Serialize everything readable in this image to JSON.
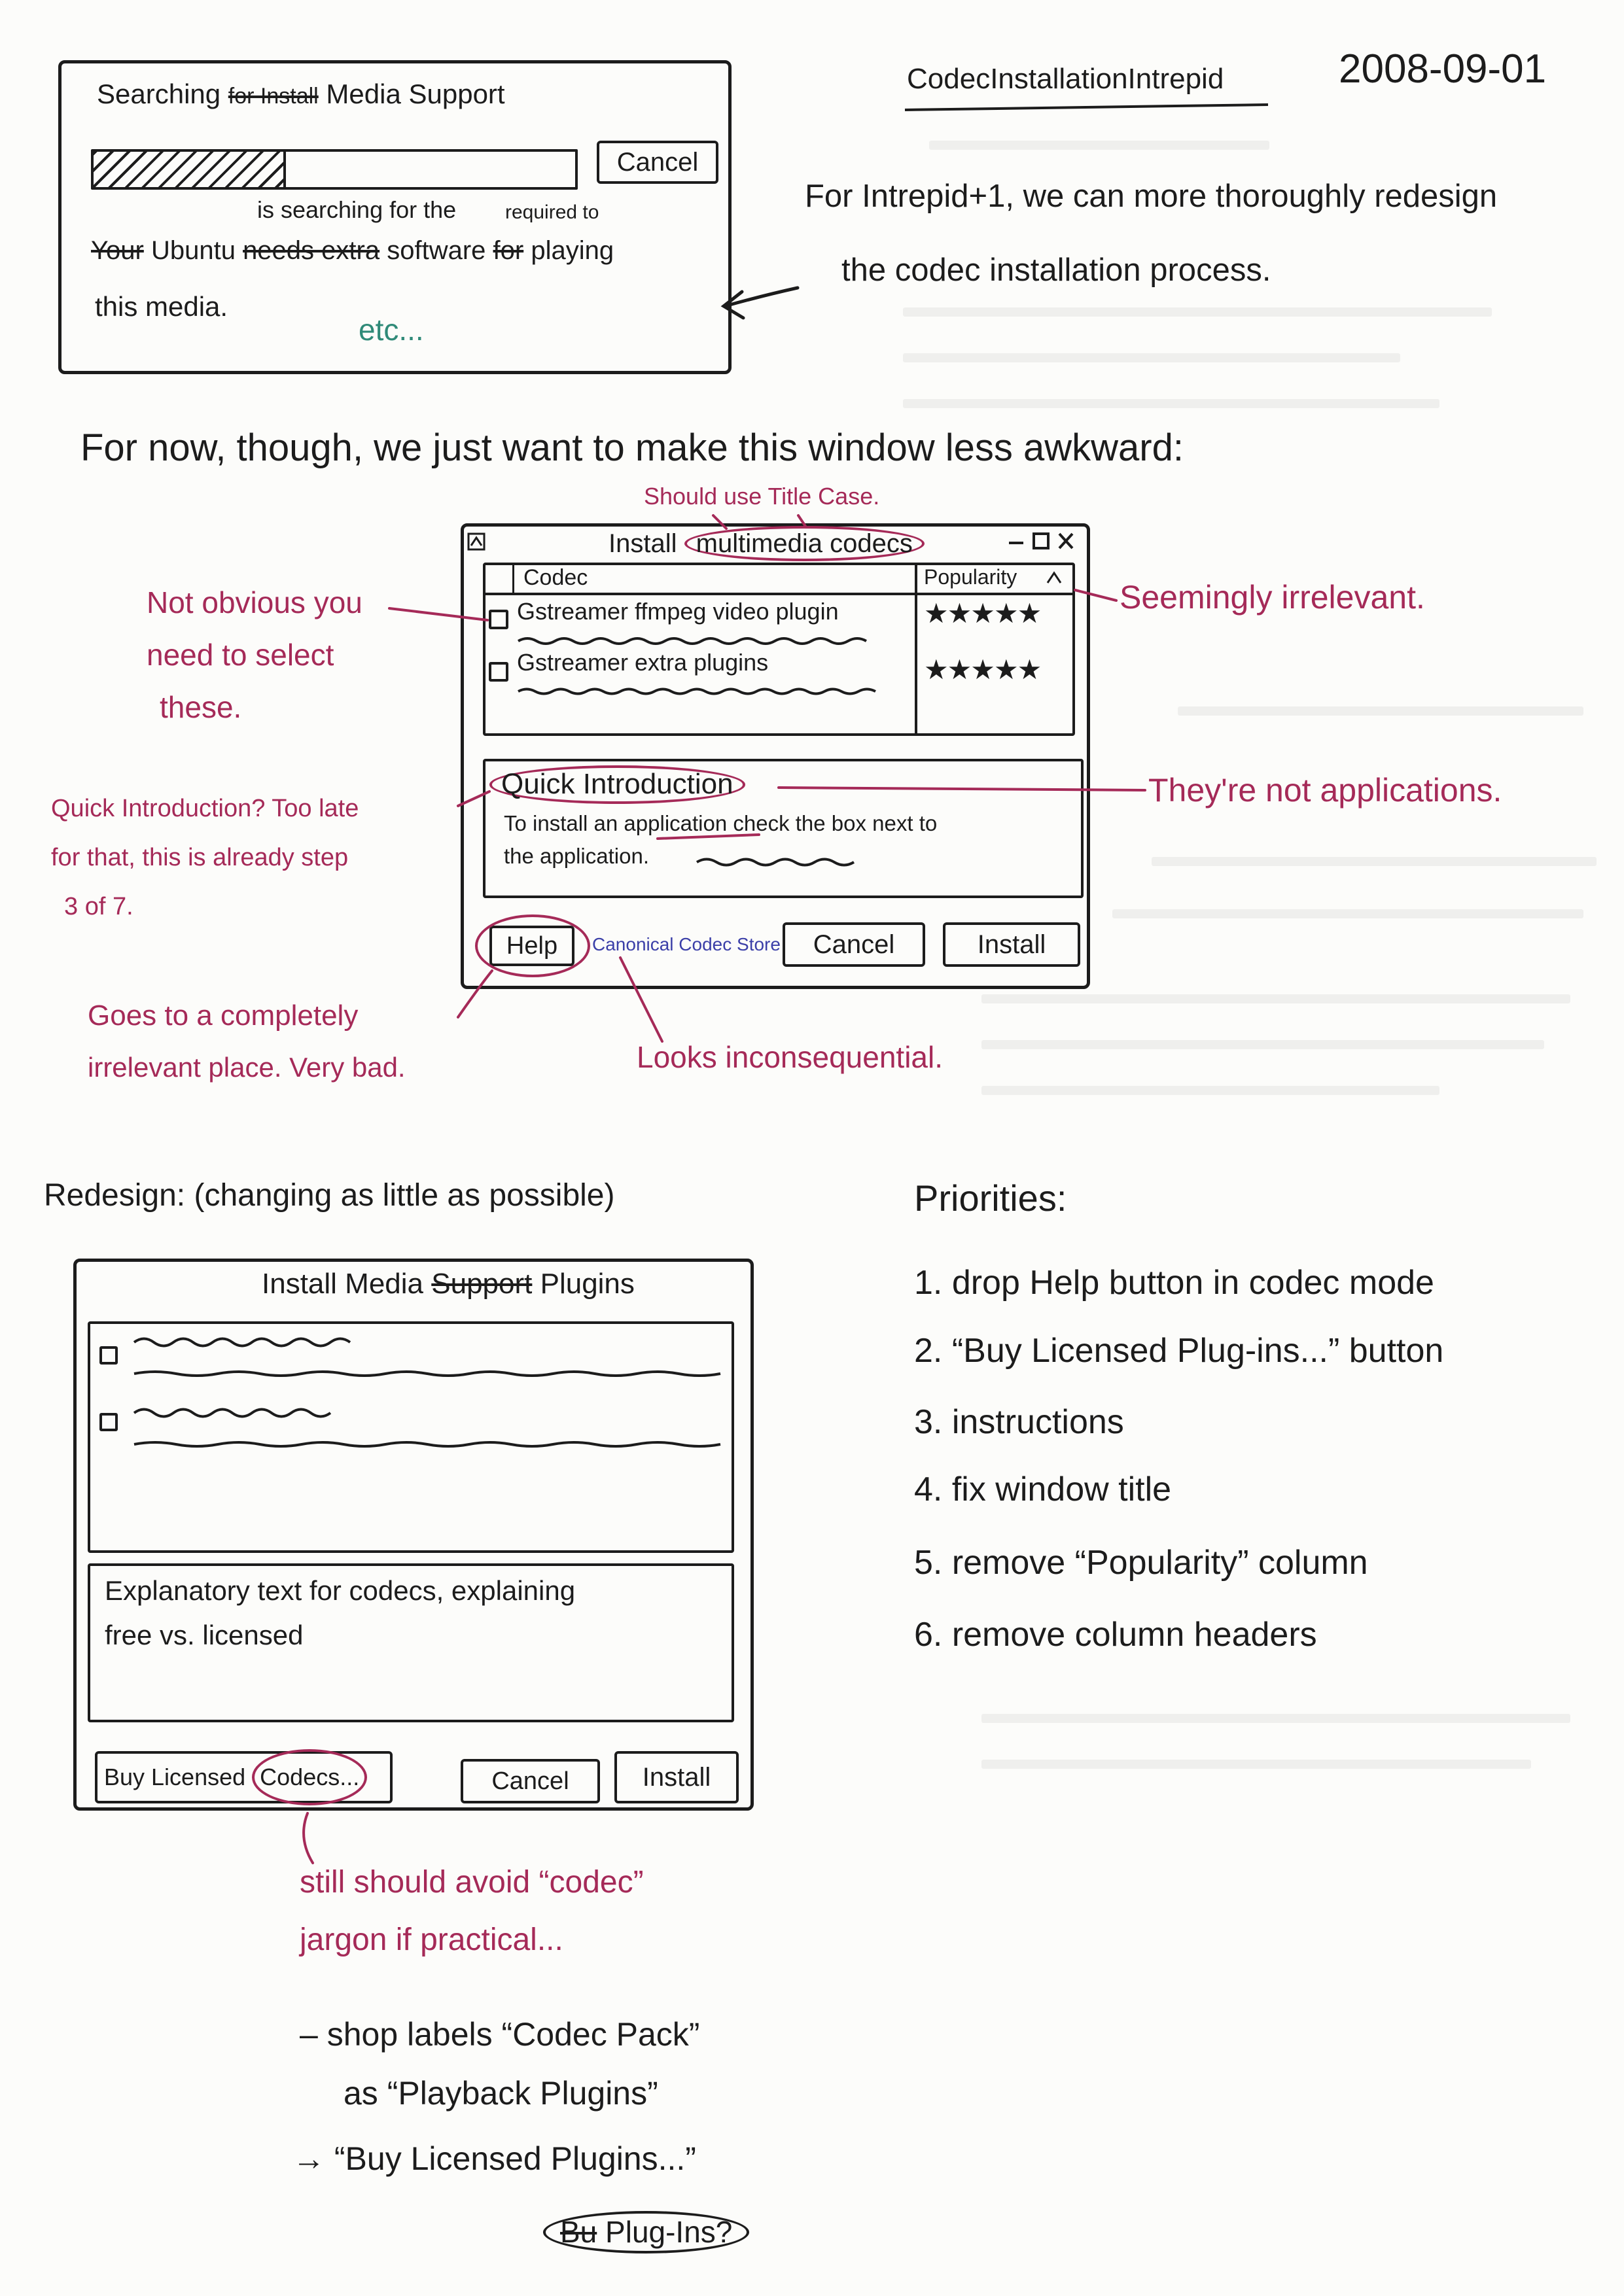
{
  "colors": {
    "ink": "#1c1c1c",
    "annotation_red": "#a52a58",
    "link_blue": "#3b3fa8",
    "etc_teal": "#2f8a78",
    "paper": "#fcfcfa"
  },
  "icons": {
    "arrow": "arrow-left-icon",
    "window": "window-icon",
    "minimize": "minimize-icon",
    "maximize": "maximize-icon",
    "close": "close-icon",
    "sort": "sort-ascending-icon",
    "checkbox": "checkbox-icon",
    "star": "star-icon"
  },
  "header": {
    "page_title": "CodecInstallationIntrepid",
    "date": "2008-09-01"
  },
  "old_dialog": {
    "title": {
      "lead": "Searching",
      "struck": "for Install",
      "tail": "Media Support"
    },
    "progress": 0.4,
    "cancel_label": "Cancel",
    "insertions": {
      "first": "is searching for the",
      "second": "required to"
    },
    "message_line": [
      {
        "text": "Your",
        "struck": true
      },
      {
        "text": "Ubuntu",
        "struck": false
      },
      {
        "text": "needs extra",
        "struck": true
      },
      {
        "text": "software",
        "struck": false
      },
      {
        "text": "for",
        "struck": true
      },
      {
        "text": "playing",
        "struck": false
      }
    ],
    "message_end": "this media.",
    "etc": "etc..."
  },
  "redesign_note": {
    "line1": "For Intrepid+1, we can more thoroughly redesign",
    "line2": "the codec installation process."
  },
  "intro_line": "For now, though, we just want to make this window less awkward:",
  "current_dialog": {
    "title_lead": "Install",
    "title_circled": "multimedia codecs",
    "columns": {
      "codec": "Codec",
      "popularity": "Popularity"
    },
    "rows": [
      {
        "name": "Gstreamer ffmpeg video plugin",
        "stars": 5
      },
      {
        "name": "Gstreamer extra plugins",
        "stars": 5
      }
    ],
    "quick_intro": {
      "title": "Quick Introduction",
      "line1": "To install an application check the box next to",
      "line2": "the application."
    },
    "buttons": {
      "help": "Help",
      "store_link": "Canonical Codec Store",
      "cancel": "Cancel",
      "install": "Install"
    }
  },
  "critique": {
    "title_case": "Should use Title Case.",
    "popularity": "Seemingly irrelevant.",
    "selection": [
      "Not obvious you",
      "need to select",
      "these."
    ],
    "quick_intro": [
      "Quick Introduction? Too late",
      "for that, this is already step",
      "3 of 7."
    ],
    "not_applications": "They're not applications.",
    "help": [
      "Goes to a completely",
      "irrelevant place. Very bad."
    ],
    "store_link": "Looks inconsequential."
  },
  "redesign": {
    "heading": "Redesign: (changing as little as possible)",
    "dialog": {
      "title_lead": "Install Media",
      "title_struck": "Support",
      "title_tail": "Plugins",
      "explanation": [
        "Explanatory text for codecs, explaining",
        "free vs. licensed"
      ],
      "buttons": {
        "buy_lead": "Buy Licensed",
        "buy_circled": "Codecs...",
        "cancel": "Cancel",
        "install": "Install"
      }
    },
    "jargon_note": [
      "still should avoid “codec”",
      "jargon if practical..."
    ],
    "label_notes": [
      "– shop labels “Codec Pack”",
      "as “Playback Plugins”",
      "→ “Buy Licensed Plugins...”"
    ],
    "alternative": {
      "struck": "Bu",
      "text": "Plug-Ins?"
    }
  },
  "priorities": {
    "heading": "Priorities:",
    "items": [
      "1. drop Help button in codec mode",
      "2. “Buy Licensed Plug-ins...” button",
      "3. instructions",
      "4. fix window title",
      "5. remove “Popularity” column",
      "6. remove column headers"
    ]
  }
}
